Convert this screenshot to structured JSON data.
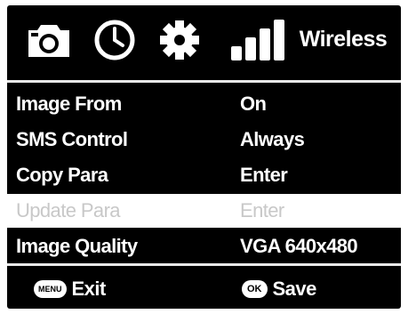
{
  "tabs": {
    "camera_icon": "camera-icon",
    "clock_icon": "clock-icon",
    "gear_icon": "gear-icon",
    "signal_icon": "signal-bars-icon",
    "wireless_label": "Wireless"
  },
  "menu": {
    "items": [
      {
        "label": "Image From",
        "value": "On",
        "enabled": true
      },
      {
        "label": "SMS Control",
        "value": "Always",
        "enabled": true
      },
      {
        "label": "Copy Para",
        "value": "Enter",
        "enabled": true
      },
      {
        "label": "Update Para",
        "value": "Enter",
        "enabled": false
      },
      {
        "label": "Image Quality",
        "value": "VGA 640x480",
        "enabled": true
      }
    ]
  },
  "footer": {
    "exit_key": "MENU",
    "exit_label": "Exit",
    "save_key": "OK",
    "save_label": "Save"
  },
  "colors": {
    "background": "#000000",
    "text": "#ffffff",
    "disabled_row_bg": "#ffffff",
    "disabled_text": "#c8c8c8"
  }
}
